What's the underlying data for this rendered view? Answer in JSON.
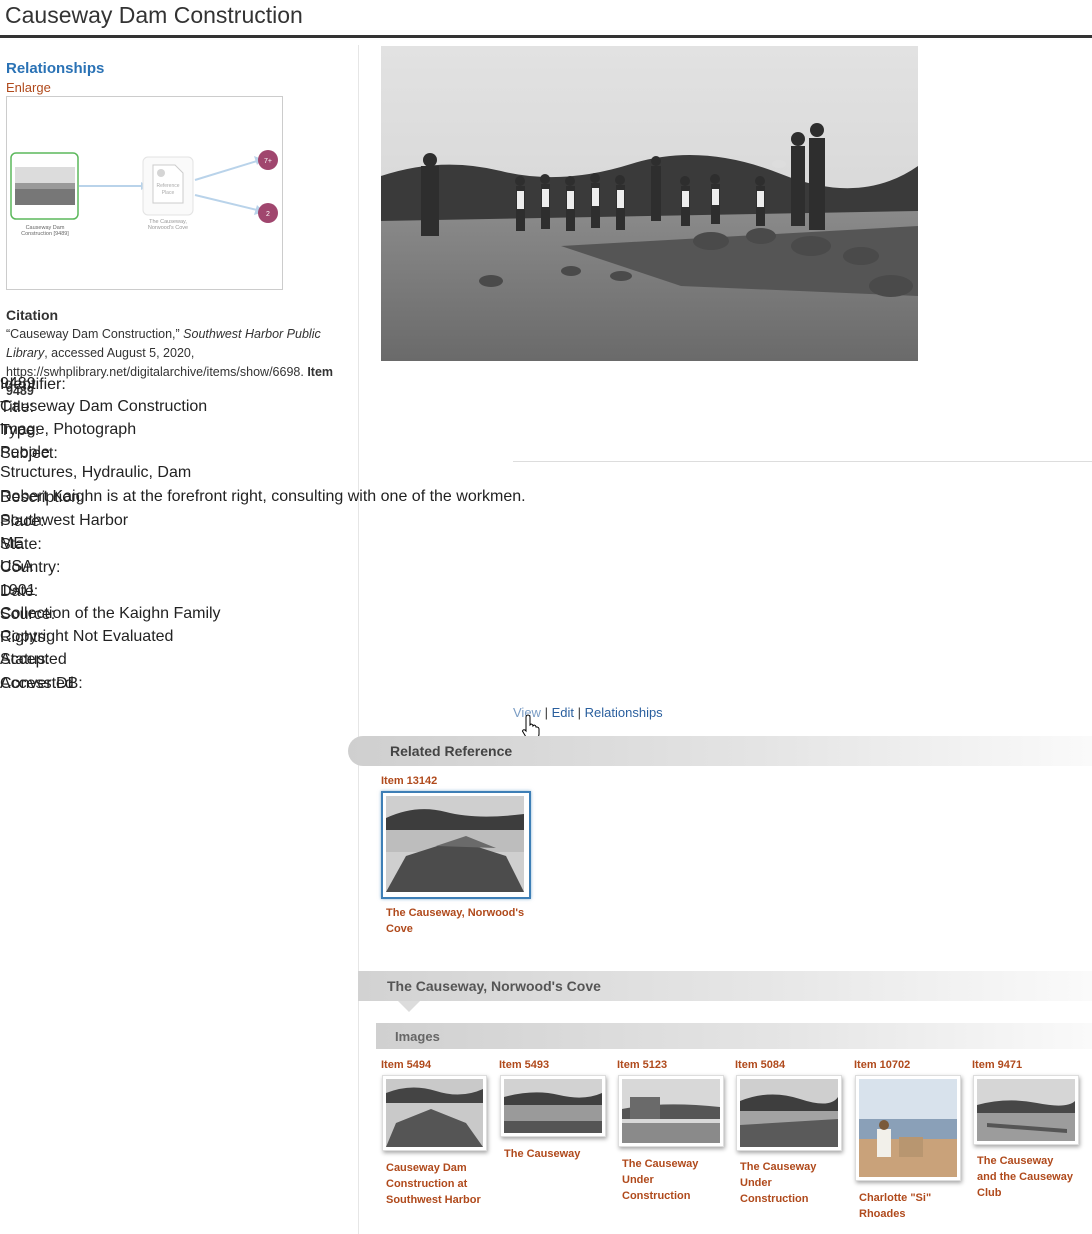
{
  "page": {
    "title": "Causeway Dam Construction"
  },
  "sidebar": {
    "relationships_title": "Relationships",
    "enlarge_label": "Enlarge",
    "graph": {
      "node_item_caption_1": "Causeway Dam",
      "node_item_caption_2": "Construction [9489]",
      "node_ref_label_1": "Reference",
      "node_ref_label_2": "Place",
      "node_ref_caption_1": "The Causeway,",
      "node_ref_caption_2": "Norwood's Cove",
      "badge_1": "7+",
      "badge_2": "2"
    },
    "citation": {
      "heading": "Citation",
      "text_1": "“Causeway Dam Construction,”",
      "source_italic": "Southwest Harbor Public Library",
      "text_2": ", accessed August 5, 2020, https://swhplibrary.net/digitalarchive/items/show/6698.",
      "item_bold": "Item 9489"
    }
  },
  "metadata": {
    "identifier": {
      "label": "Identifier:",
      "value": "9489"
    },
    "title": {
      "label": "Title:",
      "value": "Causeway Dam Construction"
    },
    "type": {
      "label": "Type:",
      "value": "Image, Photograph"
    },
    "subject": {
      "label": "Subject:",
      "value_1": "People",
      "value_2": "Structures, Hydraulic, Dam"
    },
    "description": {
      "label": "Description:",
      "value": "Robert Kaighn is at the forefront right, consulting with one of the workmen."
    },
    "place": {
      "label": "Place:",
      "value": "Southwest Harbor"
    },
    "state": {
      "label": "State:",
      "value": "ME"
    },
    "country": {
      "label": "Country:",
      "value": "USA"
    },
    "date": {
      "label": "Date:",
      "value": "1901"
    },
    "source": {
      "label": "Source:",
      "value": "Collection of the Kaighn Family"
    },
    "rights": {
      "label": "Rights:",
      "value": "Copyright Not Evaluated"
    },
    "status": {
      "label": "Status:",
      "value": "Accepted"
    },
    "access_db": {
      "label": "Access DB:",
      "value": "Converted"
    }
  },
  "actions": {
    "view": "View",
    "sep": "|",
    "edit": "Edit",
    "relationships": "Relationships"
  },
  "related_reference": {
    "heading": "Related Reference",
    "item_label": "Item 13142",
    "caption_1": "The Causeway, Norwood's",
    "caption_2": "Cove"
  },
  "place_section": {
    "heading": "The Causeway, Norwood's Cove",
    "images_heading": "Images",
    "images": [
      {
        "item": "Item 5494",
        "caption": [
          "Causeway Dam",
          "Construction at",
          "Southwest Harbor"
        ]
      },
      {
        "item": "Item 5493",
        "caption": [
          "The Causeway"
        ]
      },
      {
        "item": "Item 5123",
        "caption": [
          "The Causeway",
          "Under",
          "Construction"
        ]
      },
      {
        "item": "Item 5084",
        "caption": [
          "The Causeway",
          "Under",
          "Construction"
        ]
      },
      {
        "item": "Item 10702",
        "caption": [
          "Charlotte \"Si\"",
          "Rhoades"
        ]
      },
      {
        "item": "Item 9471",
        "caption": [
          "The Causeway",
          "and the Causeway",
          "Club"
        ]
      }
    ]
  },
  "colors": {
    "link": "#2a72b5",
    "rust": "#b04a1c",
    "badge": "#a0466e",
    "node_border": "#5cb85c"
  }
}
